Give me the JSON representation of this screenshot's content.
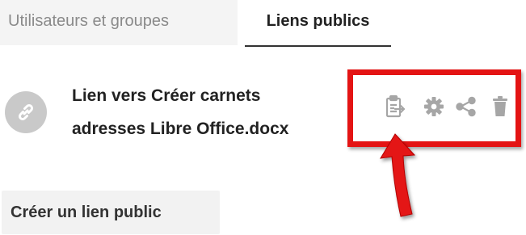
{
  "tabs": {
    "users_groups": "Utilisateurs et groupes",
    "public_links": "Liens publics",
    "active": "public_links"
  },
  "link": {
    "name_line1": "Lien vers Créer carnets",
    "name_line2": "adresses Libre Office.docx",
    "icon": "link-icon"
  },
  "actions": [
    {
      "icon": "copy-link-icon"
    },
    {
      "icon": "gear-icon"
    },
    {
      "icon": "share-icon"
    },
    {
      "icon": "trash-icon"
    }
  ],
  "create_button": {
    "label": "Créer un lien public"
  },
  "colors": {
    "highlight": "#e41414",
    "icon": "#a6a6a6",
    "avatar": "#c9c9c9"
  }
}
